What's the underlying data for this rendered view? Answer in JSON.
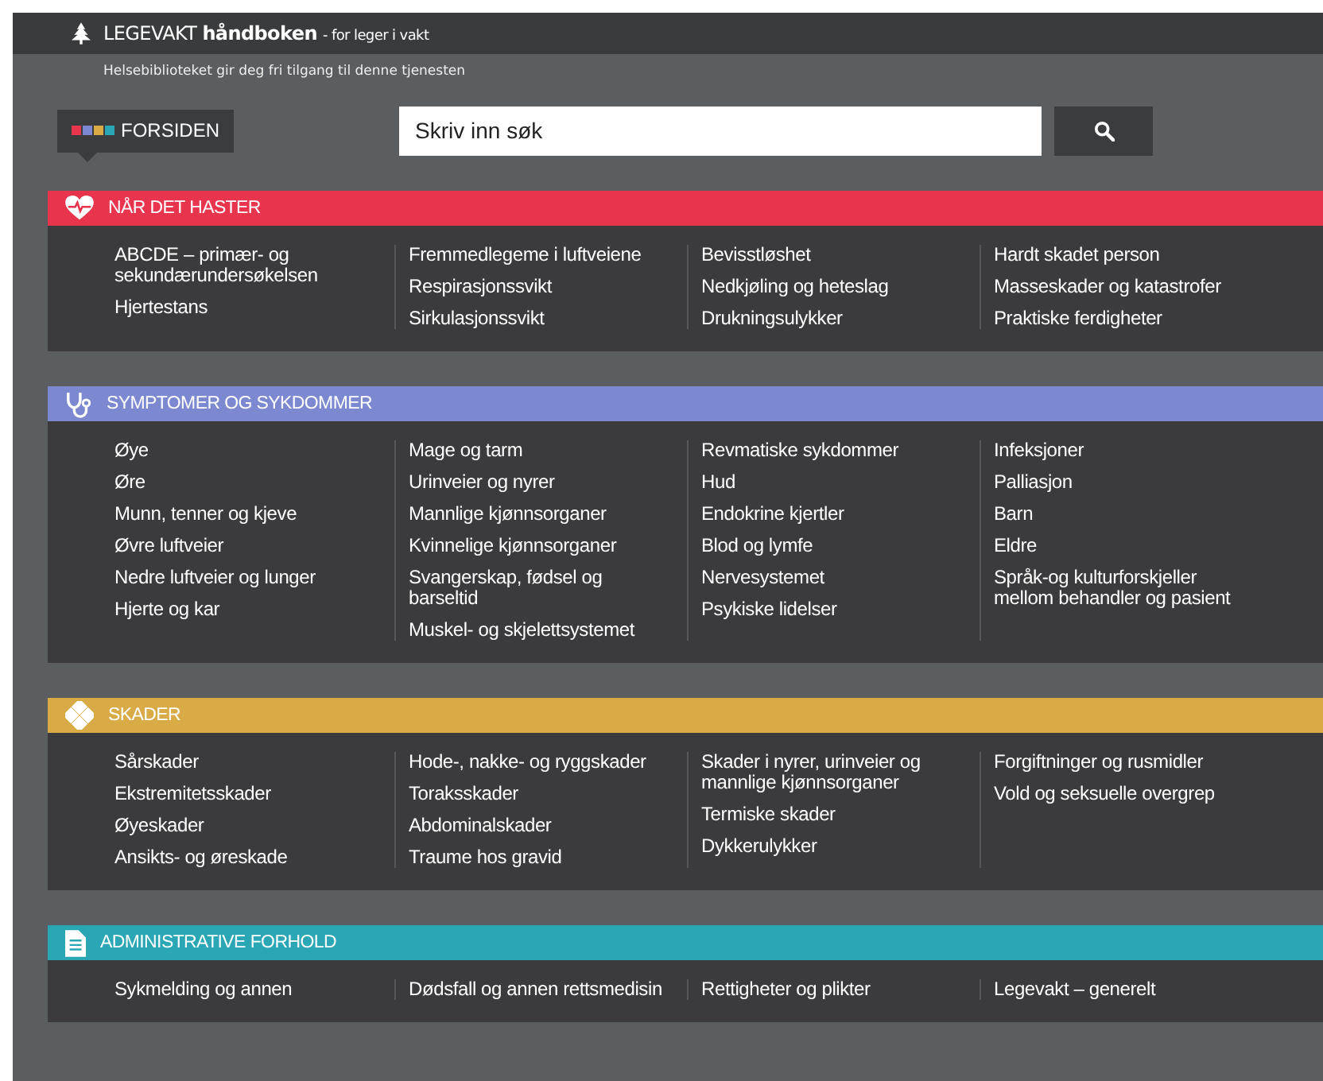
{
  "header": {
    "brand": "LEGEVAKT",
    "brand_bold": "håndboken",
    "tagline": "- for leger i vakt",
    "subtitle": "Helsebiblioteket gir deg fri tilgang til denne tjenesten"
  },
  "home_button": {
    "label": "FORSIDEN"
  },
  "search": {
    "placeholder": "Skriv inn søk"
  },
  "sections": [
    {
      "title": "NÅR DET HASTER",
      "kind": "heart",
      "color": "#e8344d",
      "columns": [
        [
          "ABCDE – primær- og sekundærundersøkelsen",
          "Hjertestans"
        ],
        [
          "Fremmedlegeme i luftveiene",
          "Respirasjonssvikt",
          "Sirkulasjonssvikt"
        ],
        [
          "Bevisstløshet",
          "Nedkjøling og heteslag",
          "Drukningsulykker"
        ],
        [
          "Hardt skadet person",
          "Masseskader og katastrofer",
          "Praktiske ferdigheter"
        ]
      ]
    },
    {
      "title": "SYMPTOMER OG SYKDOMMER",
      "kind": "stethoscope",
      "color": "#7c89d0",
      "columns": [
        [
          "Øye",
          "Øre",
          "Munn, tenner og kjeve",
          "Øvre luftveier",
          "Nedre luftveier og lunger",
          "Hjerte og kar"
        ],
        [
          "Mage og tarm",
          "Urinveier og nyrer",
          "Mannlige kjønnsorganer",
          "Kvinnelige kjønnsorganer",
          "Svangerskap, fødsel og barseltid",
          "Muskel- og skjelettsystemet"
        ],
        [
          "Revmatiske sykdommer",
          "Hud",
          "Endokrine kjertler",
          "Blod og lymfe",
          "Nervesystemet",
          "Psykiske lidelser"
        ],
        [
          "Infeksjoner",
          "Palliasjon",
          "Barn",
          "Eldre",
          "Språk-og kulturforskjeller mellom behandler og pasient"
        ]
      ]
    },
    {
      "title": "SKADER",
      "kind": "bandage",
      "color": "#d8ab47",
      "columns": [
        [
          "Sårskader",
          "Ekstremitetsskader",
          "Øyeskader",
          "Ansikts- og øreskade"
        ],
        [
          "Hode-, nakke- og ryggskader",
          "Toraksskader",
          "Abdominalskader",
          "Traume hos gravid"
        ],
        [
          "Skader i nyrer, urinveier og mannlige kjønnsorganer",
          "Termiske skader",
          "Dykkerulykker"
        ],
        [
          "Forgiftninger og rusmidler",
          "Vold og seksuelle overgrep"
        ]
      ]
    },
    {
      "title": "ADMINISTRATIVE FORHOLD",
      "kind": "document",
      "color": "#2aa6b4",
      "columns": [
        [
          "Sykmelding og annen"
        ],
        [
          "Dødsfall og annen rettsmedisin"
        ],
        [
          "Rettigheter og plikter"
        ],
        [
          "Legevakt – generelt"
        ]
      ]
    }
  ]
}
